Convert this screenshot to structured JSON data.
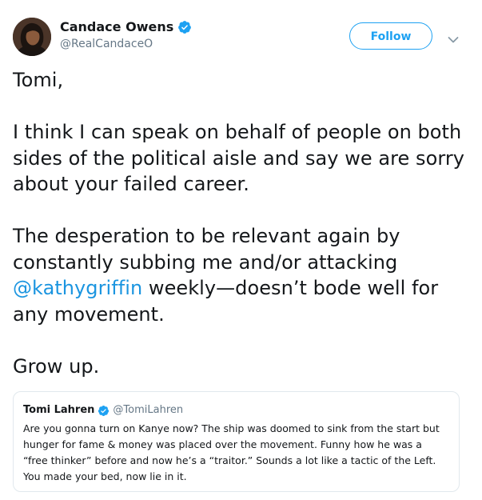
{
  "author": {
    "display_name": "Candace Owens",
    "handle": "@RealCandaceO",
    "verified": true
  },
  "follow_label": "Follow",
  "tweet": {
    "p1": "Tomi,",
    "p2": "I think I can speak on behalf of people on both sides of the political aisle and say we are sorry about your failed career.",
    "p3_before": "The desperation to be relevant again by constantly subbing me and/or attacking ",
    "p3_mention": "@kathygriffin",
    "p3_after": " weekly—doesn’t bode well for any movement.",
    "p4": "Grow up."
  },
  "quoted": {
    "display_name": "Tomi Lahren",
    "handle": "@TomiLahren",
    "verified": true,
    "text": "Are you gonna turn on Kanye now? The ship was doomed to sink from the start but hunger for fame & money was placed over the movement. Funny how he was a “free thinker” before and now he’s a “traitor.” Sounds a lot like a tactic of the Left. You made your bed, now lie in it."
  },
  "colors": {
    "accent": "#1da1f2",
    "link": "#1b95e0",
    "secondary_text": "#657786",
    "border": "#e1e8ed"
  },
  "icons": {
    "verified": "verified-badge-icon",
    "caret": "chevron-down-icon"
  }
}
